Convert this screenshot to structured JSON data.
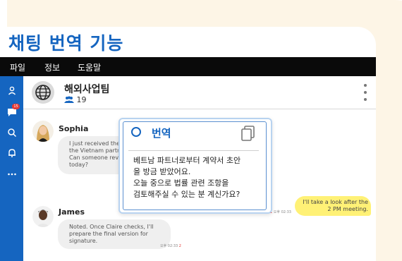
{
  "page": {
    "heading": "채팅 번역 기능"
  },
  "menu": {
    "items": [
      "파일",
      "정보",
      "도움말"
    ]
  },
  "sidebar": {
    "icons": [
      "person-icon",
      "chat-icon",
      "search-icon",
      "bell-icon",
      "more-icon"
    ],
    "chat_badge": "15"
  },
  "chat": {
    "name": "해외사업팀",
    "member_count": "19"
  },
  "messages": [
    {
      "sender": "Sophia",
      "text": "I just received the c\nthe Vietnam partne\nCan someone revie\ntoday?"
    },
    {
      "sender": "James",
      "text": "Noted. Once Claire checks, I'll\nprepare the final version for\nsignature.",
      "time": "오후 02:33",
      "unread": "2"
    }
  ],
  "my_message": {
    "text": "I'll take a look after the\n2 PM meeting.",
    "unread": "1",
    "time": "오후 02:33"
  },
  "translation_popup": {
    "title": "번역",
    "lines": [
      "베트남 파트너로부터 계약서 초안",
      "을 방금 받았어요.",
      "오늘 중으로 법률 관련 조항을",
      "검토해주실 수 있는 분 계신가요?"
    ]
  },
  "colors": {
    "brand_blue": "#1565c0",
    "my_bubble": "#fff176",
    "badge_red": "#e53935"
  }
}
